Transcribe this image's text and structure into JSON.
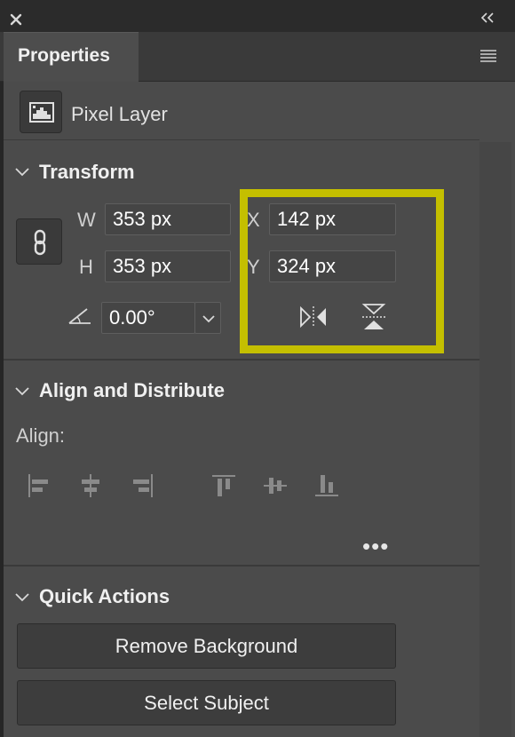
{
  "window": {
    "close_icon": "close-icon",
    "collapse_icon": "double-chevron-left-icon"
  },
  "tabs": {
    "active_label": "Properties",
    "menu_icon": "panel-menu-icon"
  },
  "layer": {
    "icon": "pixel-layer-icon",
    "label": "Pixel Layer"
  },
  "transform": {
    "title": "Transform",
    "link_icon": "link-icon",
    "w_label": "W",
    "w_value": "353 px",
    "h_label": "H",
    "h_value": "353 px",
    "x_label": "X",
    "x_value": "142 px",
    "y_label": "Y",
    "y_value": "324 px",
    "angle_icon": "angle-icon",
    "angle_value": "0.00°",
    "flip_horizontal_icon": "flip-horizontal-icon",
    "flip_vertical_icon": "flip-vertical-icon",
    "highlight_color": "#c4bf00"
  },
  "align": {
    "title": "Align and Distribute",
    "align_label": "Align:",
    "icons": [
      "align-left-icon",
      "align-horizontal-center-icon",
      "align-right-icon",
      "align-top-icon",
      "align-vertical-center-icon",
      "align-bottom-icon"
    ],
    "more_label": "•••"
  },
  "quick_actions": {
    "title": "Quick Actions",
    "remove_background": "Remove Background",
    "select_subject": "Select Subject"
  }
}
